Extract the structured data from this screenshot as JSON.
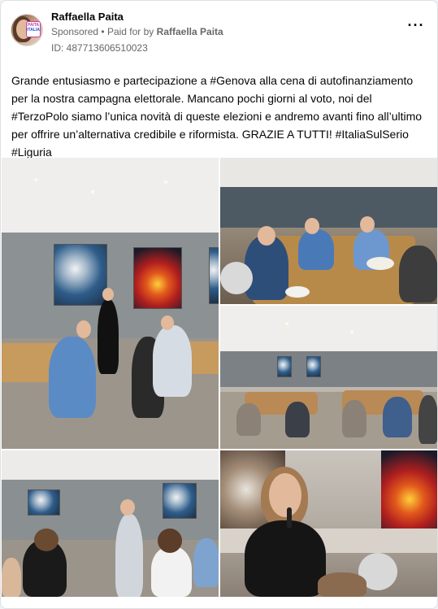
{
  "post": {
    "author": "Raffaella Paita",
    "sponsored_label": "Sponsored",
    "separator": "•",
    "paid_for_prefix": "Paid for by",
    "paid_for_by": "Raffaella Paita",
    "ad_id": "ID: 487713606510023",
    "more_icon": "more-horizontal-icon",
    "avatar_badge_line1": "PAITA",
    "avatar_badge_line2": "ITALIA",
    "text_lines": [
      "Grande entusiasmo e partecipazione a #Genova alla cena di autofinanziamento",
      "per la nostra campagna elettorale. Mancano pochi giorni al voto, noi del",
      "#TerzoPolo siamo l’unica novità di queste elezioni e andremo avanti fino all’ultimo",
      "per offrire un’alternativa credibile e riformista. GRAZIE A TUTTI! #ItaliaSulSerio",
      "#Liguria"
    ]
  },
  "photos": [
    {
      "name": "photo-dinner-room-wide"
    },
    {
      "name": "photo-diners-table"
    },
    {
      "name": "photo-room-overview"
    },
    {
      "name": "photo-speaker-room"
    },
    {
      "name": "photo-speaker-closeup"
    }
  ],
  "colors": {
    "secondary_text": "#65676b",
    "primary_text": "#050505",
    "card_border": "#dddfe2"
  }
}
